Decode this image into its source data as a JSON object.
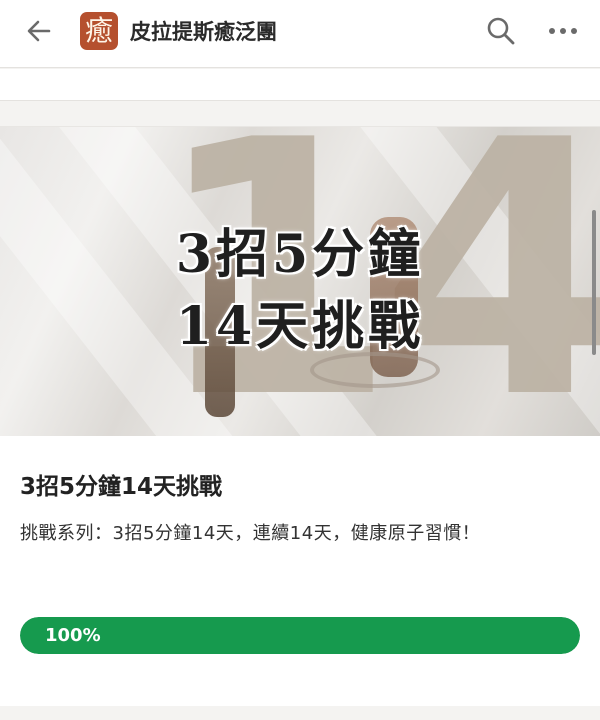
{
  "appbar": {
    "back_icon": "arrow-left-icon",
    "logo_glyph": "癒",
    "logo_color": "#b5502e",
    "title": "皮拉提斯癒泛團",
    "search_icon": "search-icon",
    "more_icon": "more-horizontal-icon"
  },
  "card": {
    "banner": {
      "big_number": "14",
      "line1": "3招5分鐘",
      "line2": "14天挑戰"
    },
    "title": "3招5分鐘14天挑戰",
    "description": "挑戰系列：3招5分鐘14天，連續14天，健康原子習慣！",
    "progress": {
      "label": "100%",
      "value": 1.0,
      "color": "#169a4e"
    }
  }
}
